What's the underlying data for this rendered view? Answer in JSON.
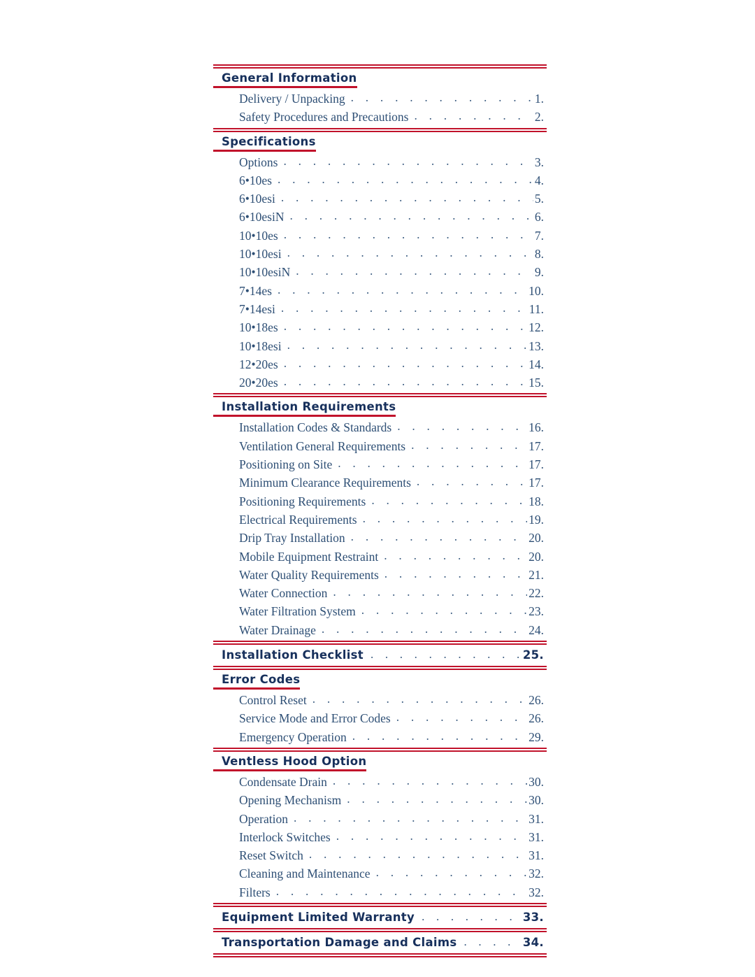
{
  "document": {
    "type": "table-of-contents",
    "text_color": "#2e4f75",
    "heading_color": "#17305c",
    "rule_color": "#c1122b",
    "background": "#ffffff",
    "leader_dots": ". . . . . . . . . . . . . . . . . . . . . . . . . . . . . . . . . . . . . . . . . ."
  },
  "sections": [
    {
      "heading": "General Information",
      "has_page_number": false,
      "entries": [
        {
          "label": "Delivery / Unpacking",
          "page": "1."
        },
        {
          "label": "Safety Procedures and Precautions",
          "page": "2."
        }
      ]
    },
    {
      "heading": "Specifications",
      "has_page_number": false,
      "entries": [
        {
          "label": "Options",
          "page": "3."
        },
        {
          "label": "6•10es",
          "page": "4."
        },
        {
          "label": "6•10esi",
          "page": "5."
        },
        {
          "label": "6•10esiN",
          "page": "6."
        },
        {
          "label": "10•10es",
          "page": "7."
        },
        {
          "label": "10•10esi",
          "page": "8."
        },
        {
          "label": "10•10esiN",
          "page": "9."
        },
        {
          "label": "7•14es",
          "page": "10."
        },
        {
          "label": "7•14esi",
          "page": "11."
        },
        {
          "label": "10•18es",
          "page": "12."
        },
        {
          "label": "10•18esi",
          "page": "13."
        },
        {
          "label": "12•20es",
          "page": "14."
        },
        {
          "label": "20•20es",
          "page": "15."
        }
      ]
    },
    {
      "heading": "Installation Requirements",
      "has_page_number": false,
      "entries": [
        {
          "label": "Installation Codes & Standards",
          "page": "16."
        },
        {
          "label": "Ventilation General Requirements",
          "page": "17."
        },
        {
          "label": "Positioning on Site",
          "page": "17."
        },
        {
          "label": "Minimum Clearance Requirements",
          "page": "17."
        },
        {
          "label": "Positioning Requirements",
          "page": "18."
        },
        {
          "label": "Electrical Requirements",
          "page": "19."
        },
        {
          "label": "Drip Tray Installation",
          "page": "20."
        },
        {
          "label": "Mobile Equipment Restraint",
          "page": "20."
        },
        {
          "label": "Water Quality Requirements",
          "page": "21."
        },
        {
          "label": "Water Connection",
          "page": "22."
        },
        {
          "label": "Water Filtration System",
          "page": "23."
        },
        {
          "label": "Water Drainage",
          "page": "24."
        }
      ]
    },
    {
      "heading": "Installation Checklist",
      "has_page_number": true,
      "page": "25.",
      "entries": []
    },
    {
      "heading": "Error Codes",
      "has_page_number": false,
      "entries": [
        {
          "label": "Control Reset",
          "page": "26."
        },
        {
          "label": "Service Mode and Error Codes",
          "page": "26."
        },
        {
          "label": "Emergency Operation",
          "page": "29."
        }
      ]
    },
    {
      "heading": "Ventless Hood Option",
      "has_page_number": false,
      "entries": [
        {
          "label": "Condensate Drain",
          "page": "30."
        },
        {
          "label": "Opening Mechanism",
          "page": "30."
        },
        {
          "label": "Operation",
          "page": "31."
        },
        {
          "label": "Interlock Switches",
          "page": "31."
        },
        {
          "label": "Reset Switch",
          "page": "31."
        },
        {
          "label": "Cleaning and Maintenance",
          "page": "32."
        },
        {
          "label": "Filters",
          "page": "32."
        }
      ]
    },
    {
      "heading": "Equipment Limited Warranty",
      "has_page_number": true,
      "page": "33.",
      "entries": []
    },
    {
      "heading": "Transportation Damage and Claims",
      "has_page_number": true,
      "page": "34.",
      "entries": []
    }
  ]
}
